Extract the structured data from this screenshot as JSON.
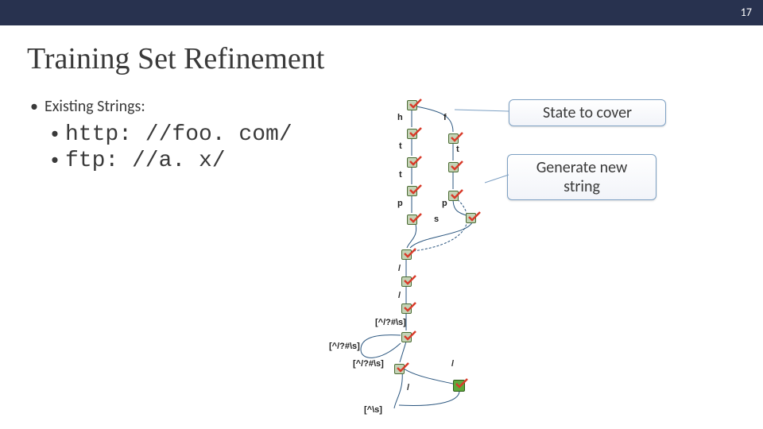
{
  "slide_number": "17",
  "title": "Training Set Refinement",
  "existing_label": "Existing Strings:",
  "strings": {
    "s0": "http: //foo. com/",
    "s1": "ftp: //a. x/"
  },
  "callouts": {
    "state_to_cover": "State to cover",
    "generate_new": "Generate new string"
  },
  "edge_labels": {
    "h": "h",
    "f": "f",
    "t1": "t",
    "t2": "t",
    "t3": "t",
    "p1": "p",
    "p2": "p",
    "s": "s",
    "slash1": "/",
    "slash2": "/",
    "cc1": "[^/?#\\s]",
    "cc2": "[^/?#\\s]",
    "cc3": "[^/?#\\s]",
    "slash3": "/",
    "slash4": "/",
    "cc4": "[^\\s]"
  }
}
